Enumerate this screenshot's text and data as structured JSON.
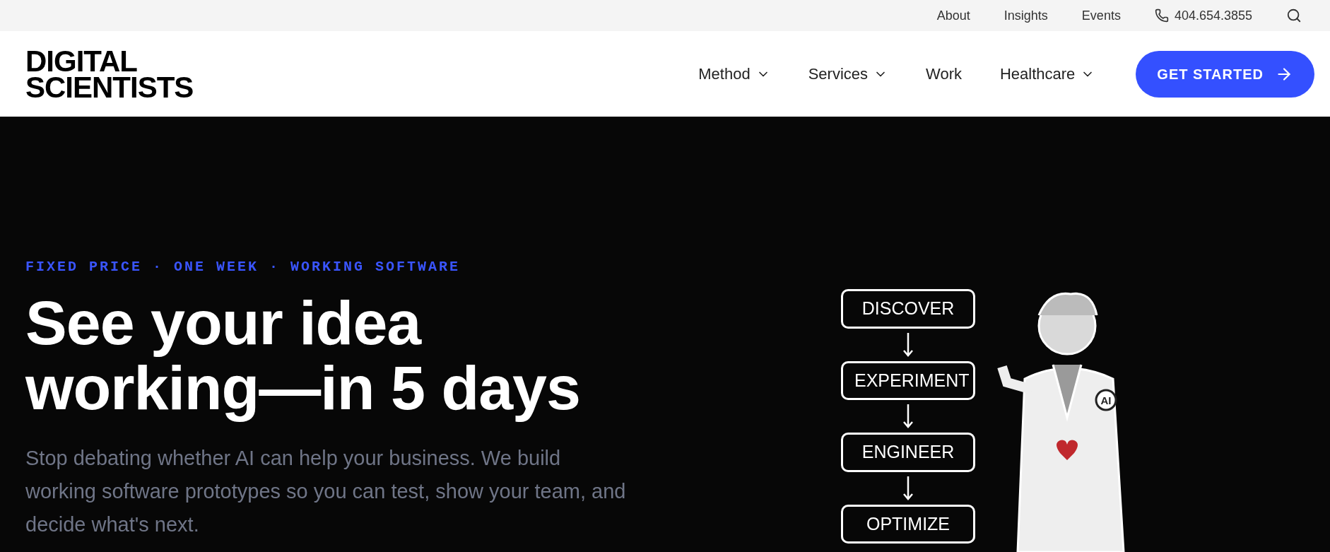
{
  "top_bar": {
    "links": [
      "About",
      "Insights",
      "Events"
    ],
    "phone": "404.654.3855"
  },
  "header": {
    "logo": [
      "DIGITAL",
      "SCIENTISTS"
    ],
    "nav": [
      {
        "label": "Method",
        "dropdown": true
      },
      {
        "label": "Services",
        "dropdown": true
      },
      {
        "label": "Work",
        "dropdown": false
      },
      {
        "label": "Healthcare",
        "dropdown": true
      }
    ],
    "cta": "GET STARTED"
  },
  "hero": {
    "eyebrow": "FIXED PRICE · ONE WEEK · WORKING SOFTWARE",
    "headline": [
      "See your idea",
      "working—in 5 days"
    ],
    "body": "Stop debating whether AI can help your business. We build working software prototypes so you can test, show your team, and decide what's next.",
    "illustration": {
      "steps": [
        "DISCOVER",
        "EXPERIMENT",
        "ENGINEER",
        "OPTIMIZE"
      ],
      "badge": "AI"
    }
  }
}
